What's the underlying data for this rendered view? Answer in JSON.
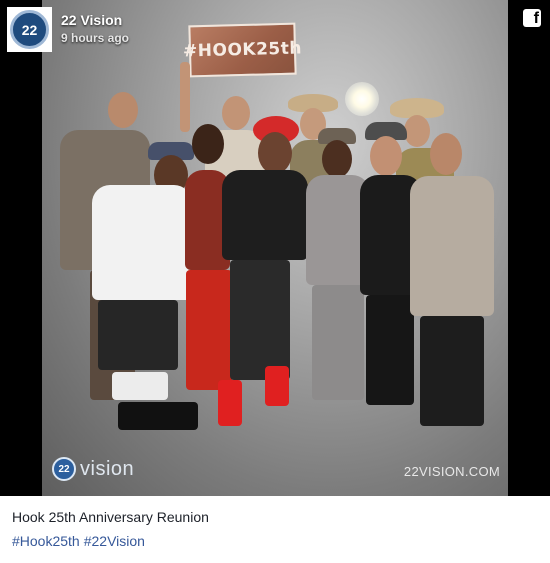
{
  "header": {
    "author_name": "22 Vision",
    "timestamp": "9 hours ago",
    "avatar_text": "22",
    "share_icon": "facebook-icon"
  },
  "photo": {
    "sign_text": "#HOOK25th",
    "watermark_logo_text": "22",
    "watermark_brand": "vision",
    "watermark_url": "22VISION.COM"
  },
  "post": {
    "caption": "Hook 25th Anniversary Reunion",
    "hashtags": [
      "#Hook25th",
      "#22Vision"
    ]
  },
  "colors": {
    "link": "#365899",
    "brand_blue": "#1f4b7e",
    "text": "#1d2129"
  }
}
